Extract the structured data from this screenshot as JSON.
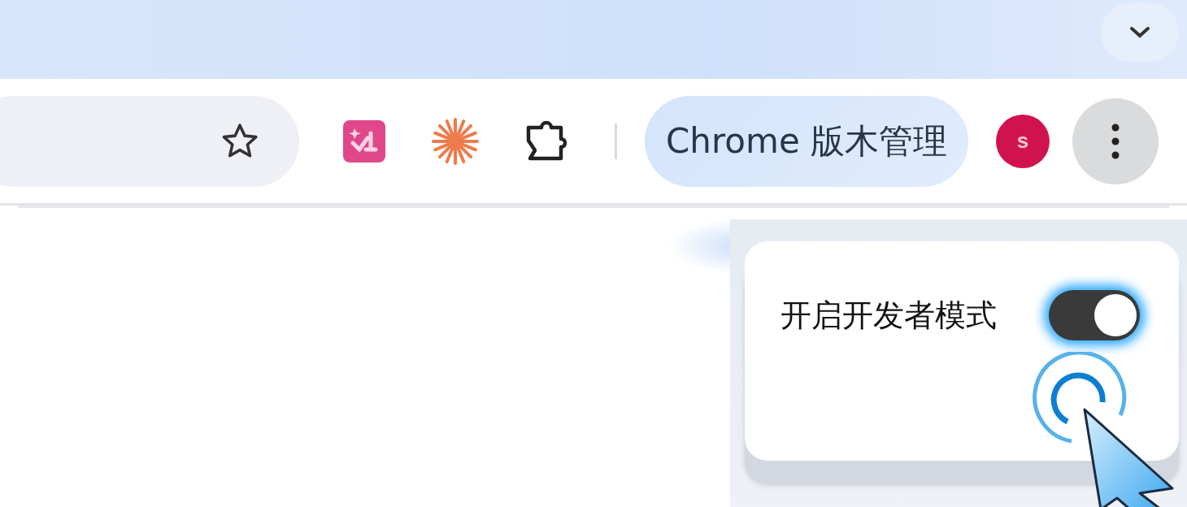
{
  "toolbar": {
    "extensions": [
      {
        "kind": "translate"
      },
      {
        "kind": "burst"
      },
      {
        "kind": "puzzle"
      }
    ],
    "version_button": {
      "label": "Chrome 版木管理"
    },
    "avatar": {
      "letter": "s"
    }
  },
  "popup": {
    "toggle": {
      "label": "开启开发者模式",
      "on": true
    }
  }
}
